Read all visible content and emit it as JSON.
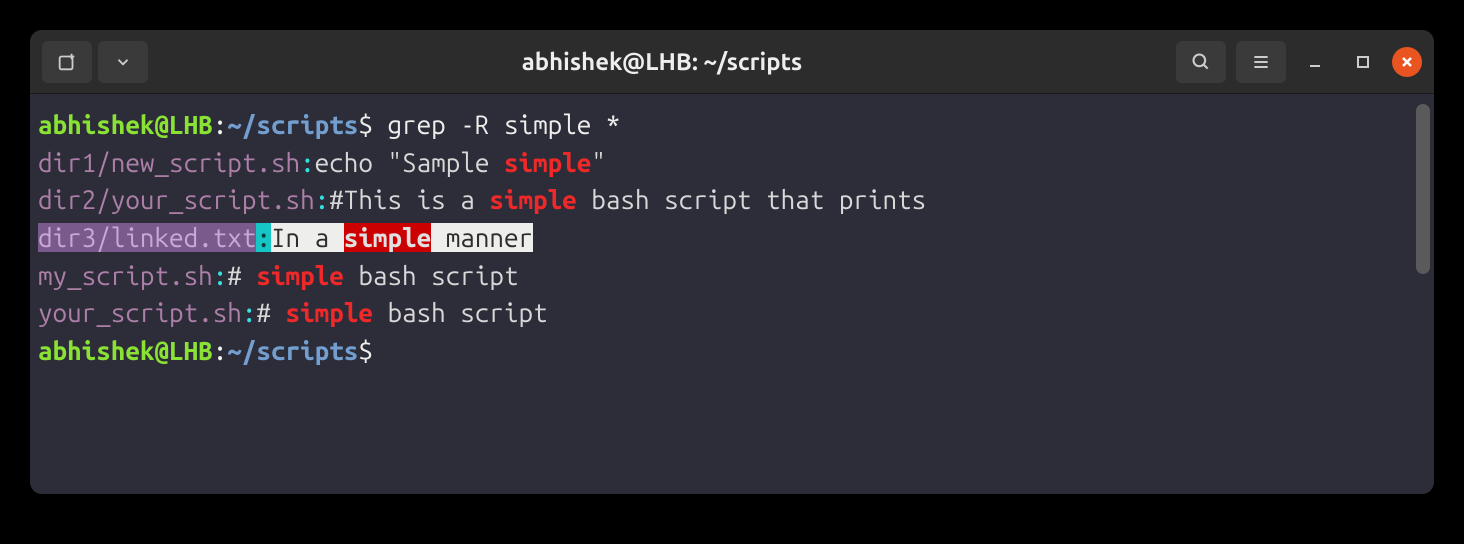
{
  "window": {
    "title": "abhishek@LHB: ~/scripts"
  },
  "prompt": {
    "user_host": "abhishek@LHB",
    "sep": ":",
    "path": "~/scripts",
    "symbol": "$"
  },
  "command": "grep -R simple *",
  "output": {
    "lines": [
      {
        "path": "dir1/new_script.sh",
        "before": "echo \"Sample ",
        "match": "simple",
        "after": "\""
      },
      {
        "path": "dir2/your_script.sh",
        "before": "#This is a ",
        "match": "simple",
        "after": " bash script that prints"
      },
      {
        "path": "dir3/linked.txt",
        "before": "In a ",
        "match": "simple",
        "after": " manner",
        "selected": true
      },
      {
        "path": "my_script.sh",
        "before": "# ",
        "match": "simple",
        "after": " bash script"
      },
      {
        "path": "your_script.sh",
        "before": "# ",
        "match": "simple",
        "after": " bash script"
      }
    ]
  },
  "colors": {
    "background": "#2d2d3a",
    "prompt_green": "#8ae234",
    "path_blue": "#729fcf",
    "file_purple": "#ad7fa8",
    "colon_cyan": "#34e2e2",
    "match_red": "#ef2929",
    "close_btn": "#e95420"
  }
}
